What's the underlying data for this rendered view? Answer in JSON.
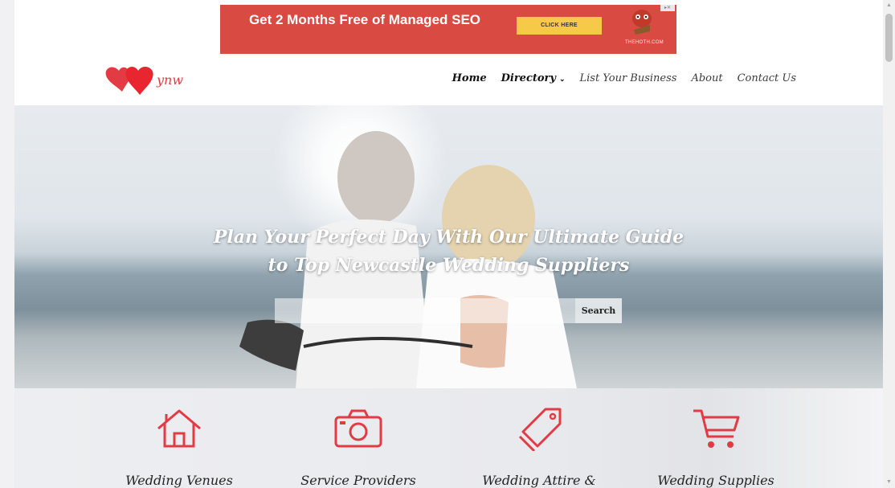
{
  "ad": {
    "headline": "Get 2 Months Free of Managed SEO",
    "cta": "CLICK HERE",
    "brand": "THEHOTH.COM",
    "close": "▸✕"
  },
  "header": {
    "logo_text": "ynw",
    "nav": [
      {
        "label": "Home"
      },
      {
        "label": "Directory"
      },
      {
        "label": "List Your Business"
      },
      {
        "label": "About"
      },
      {
        "label": "Contact Us"
      }
    ]
  },
  "hero": {
    "title_line1": "Plan Your Perfect Day With Our Ultimate Guide",
    "title_line2": "to Top Newcastle Wedding Suppliers",
    "search_placeholder": "",
    "search_button": "Search"
  },
  "categories": [
    {
      "label": "Wedding Venues",
      "icon": "house-icon"
    },
    {
      "label": "Service Providers",
      "icon": "camera-icon"
    },
    {
      "label": "Wedding Attire &",
      "icon": "tag-icon"
    },
    {
      "label": "Wedding Supplies",
      "icon": "cart-icon"
    }
  ],
  "colors": {
    "accent": "#e23b43",
    "ad_bg": "#d94a43",
    "ad_cta": "#f7c948"
  }
}
